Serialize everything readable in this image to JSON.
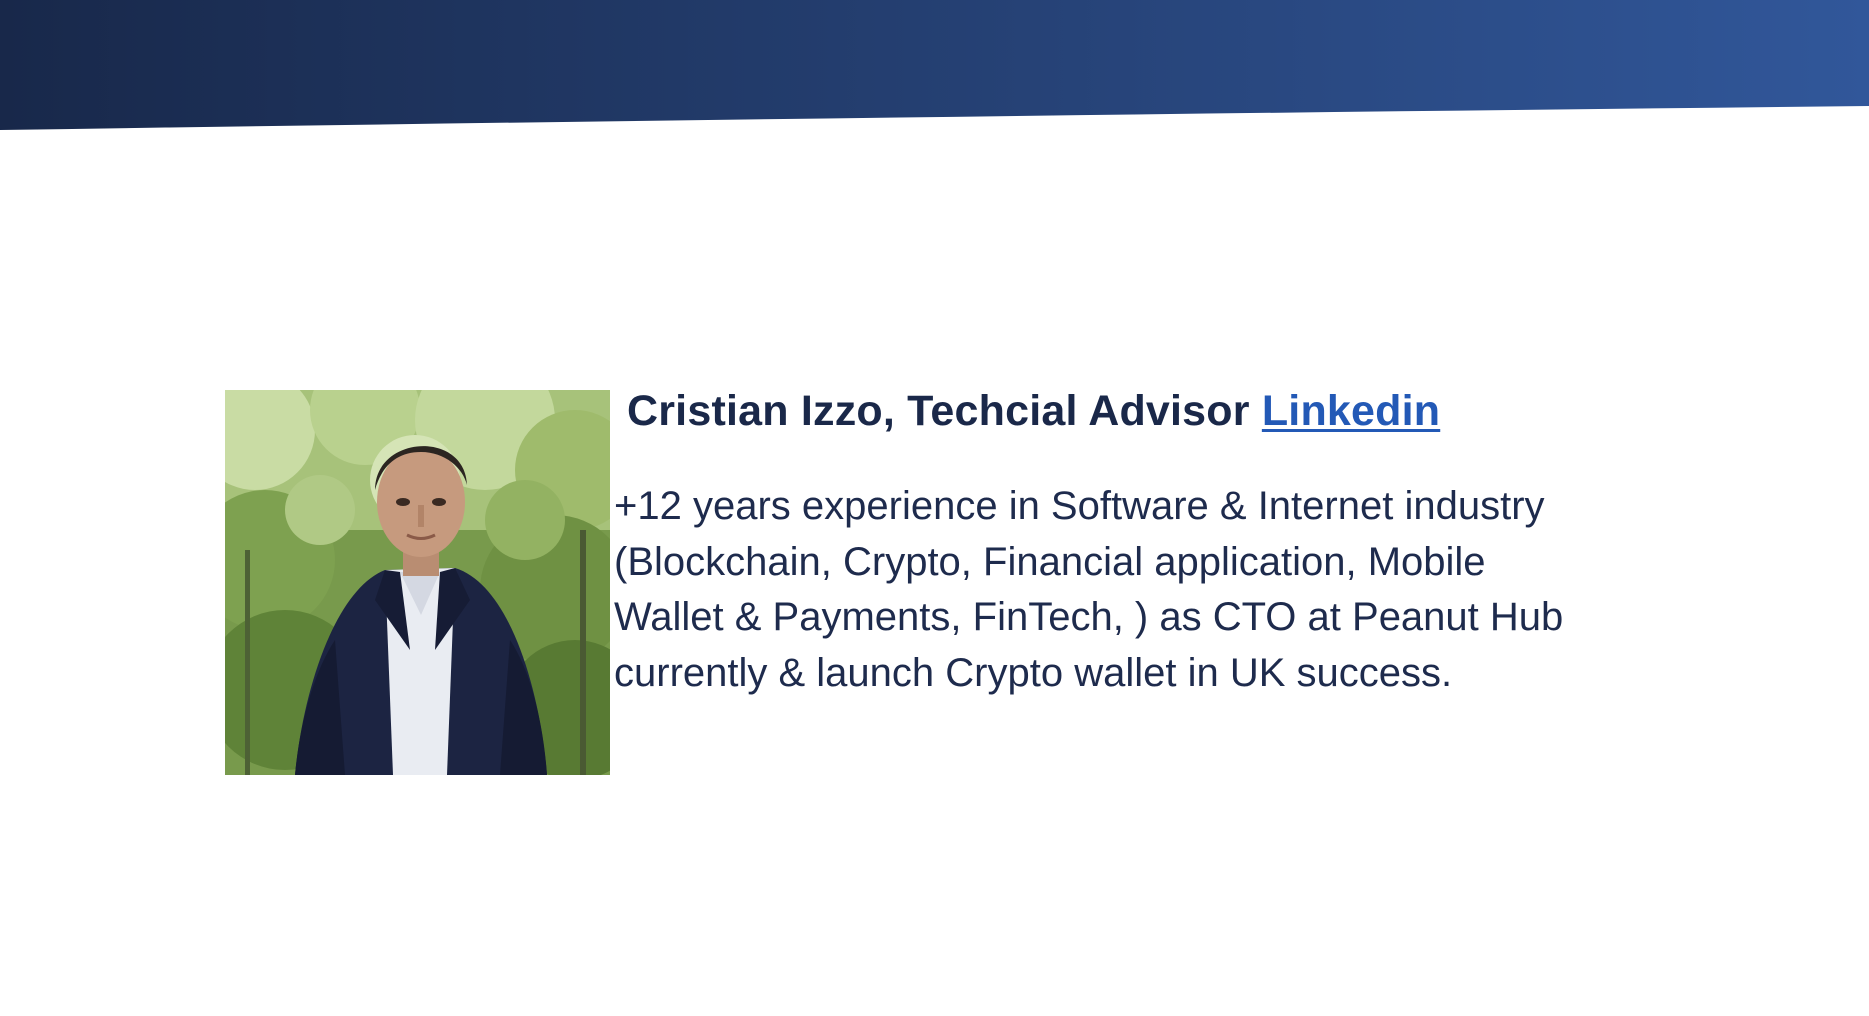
{
  "header": {
    "gradient_start": "#18284a",
    "gradient_end": "#31579a"
  },
  "profile": {
    "name_title": "Cristian Izzo, Techcial  Advisor",
    "link_label": "Linkedin",
    "link_color": "#2359b6",
    "text_color": "#1a2849",
    "bio_lines": [
      " +12 years experience in Software & Internet industry",
      "(Blockchain, Crypto,  Financial application, Mobile",
      "Wallet & Payments, FinTech, ) as CTO at Peanut Hub",
      "currently & launch Crypto wallet in UK success."
    ]
  }
}
